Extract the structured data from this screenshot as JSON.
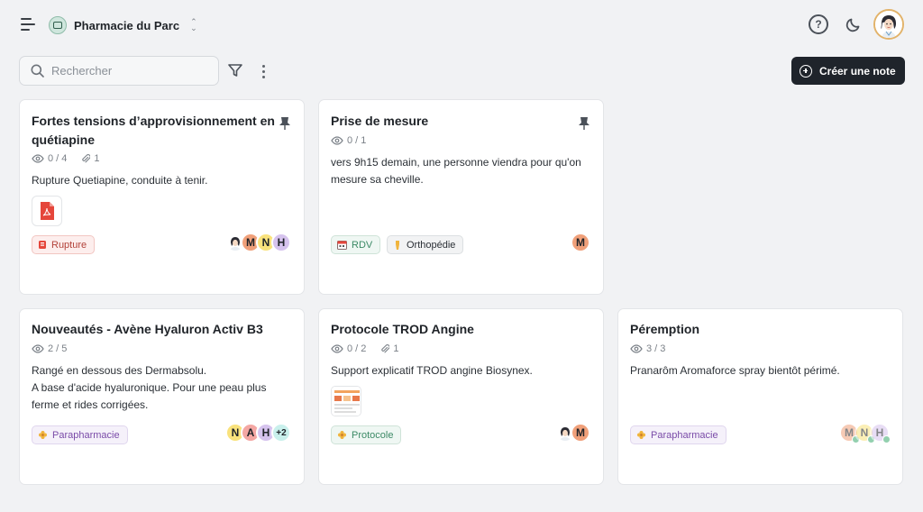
{
  "header": {
    "pharmacy_name": "Pharmacie du Parc",
    "icons": [
      "menu-icon",
      "help-icon",
      "moon-icon",
      "user-avatar"
    ]
  },
  "toolbar": {
    "search_placeholder": "Rechercher",
    "create_label": "Créer une note"
  },
  "colors": {
    "background": "#f1f2f4",
    "primary_button": "#1f242b",
    "tag_rupture": "#b3423a",
    "tag_green": "#3c8a66",
    "tag_purple": "#7a4ba8",
    "avatar_M": "#f0a07a",
    "avatar_N": "#f9e27c",
    "avatar_H": "#d6c3ee",
    "avatar_A": "#f4a7a3",
    "avatar_more": "#c9f0ec"
  },
  "cards": [
    {
      "title_line1": "Fortes tensions d’approvisionnement en",
      "title_line2": "quétiapine",
      "views": "0 / 4",
      "attachments": "1",
      "body": "Rupture Quetiapine, conduite à tenir.",
      "pinned": true,
      "tags": [
        {
          "label": "Rupture",
          "icon": "rupture-icon"
        }
      ],
      "avatars": [
        "photo",
        "M",
        "N",
        "H"
      ]
    },
    {
      "title": "Prise de mesure",
      "views": "0 / 1",
      "body_line1": "vers 9h15 demain, une personne viendra pour qu'on",
      "body_line2": "mesure sa cheville.",
      "pinned": true,
      "tags": [
        {
          "label": "RDV",
          "icon": "calendar-icon"
        },
        {
          "label": "Orthopédie",
          "icon": "bone-icon"
        }
      ],
      "avatars": [
        "M"
      ]
    },
    {
      "title": "Nouveautés - Avène Hyaluron Activ B3",
      "views": "2 / 5",
      "body_line1": "Rangé en dessous des Dermabsolu.",
      "body_line2": "A base d'acide hyaluronique.  Pour une peau plus",
      "body_line3": "ferme et rides corrigées.",
      "tags": [
        {
          "label": "Parapharmacie",
          "icon": "flower-icon"
        }
      ],
      "avatars": [
        "N",
        "A",
        "H",
        "+2"
      ]
    },
    {
      "title": "Protocole TROD Angine",
      "views": "0 / 2",
      "attachments": "1",
      "body": "Support explicatif TROD angine Biosynex.",
      "tags": [
        {
          "label": "Protocole",
          "icon": "flower-icon"
        }
      ],
      "avatars": [
        "photo",
        "M"
      ]
    },
    {
      "title": "Péremption",
      "views": "3 / 3",
      "body": "Pranarôm Aromaforce spray bientôt périmé.",
      "tags": [
        {
          "label": "Parapharmacie",
          "icon": "flower-icon"
        }
      ],
      "avatars": [
        "M",
        "N",
        "H"
      ]
    }
  ]
}
